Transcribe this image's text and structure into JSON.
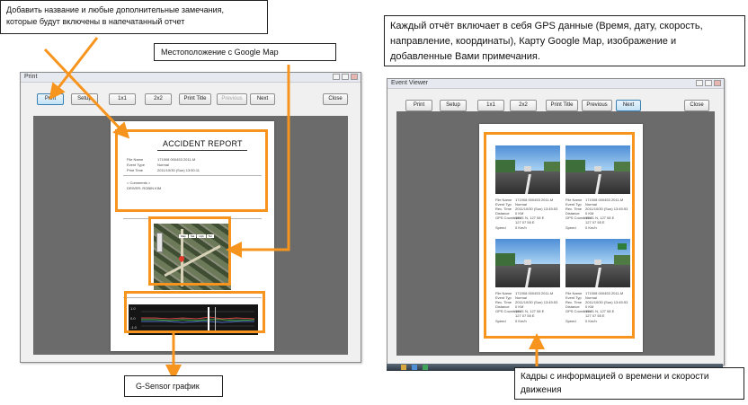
{
  "callouts": {
    "notes": [
      "Добавить название и любые дополнительные замечания,",
      "которые будут включены в напечатанный отчет"
    ],
    "google_map": "Местоположение с Google Map",
    "gps_info": [
      "Каждый отчёт включает в себя GPS данные (Время, дату, скорость,",
      "направление, координаты), Карту Google Map, изображение и",
      "добавленные Вами примечания."
    ],
    "gsensor": "G-Sensor график",
    "frames": [
      "Кадры с информацией о времени и скорости",
      "движения"
    ]
  },
  "left_window": {
    "title": "Print",
    "buttons": {
      "print": "Print",
      "setup": "Setup",
      "one_by_one": "1x1",
      "two_by_two": "2x2",
      "print_title": "Print Title",
      "previous": "Previous",
      "next": "Next",
      "close": "Close"
    },
    "report": {
      "title": "ACCIDENT REPORT",
      "fields": [
        {
          "label": "File Name",
          "value": "171908 000453 2011-M"
        },
        {
          "label": "Event Type",
          "value": "Normal"
        },
        {
          "label": "Print Time",
          "value": "2011/10/30 (Sun) 13:50:11"
        }
      ],
      "comments_label": "< Comments >",
      "comments_value": "DRIVER: ROBIN KIM"
    },
    "map_tabs": [
      "Map",
      "Sat",
      "Hyb",
      "Ter"
    ],
    "graph": {
      "y_labels": [
        "1.0",
        "0.0",
        "-1.0"
      ],
      "times": [
        "11:44:53",
        "11:44:58",
        "11:45"
      ]
    }
  },
  "right_window": {
    "title": "Event Viewer",
    "buttons": {
      "print": "Print",
      "setup": "Setup",
      "one_by_one": "1x1",
      "two_by_two": "2x2",
      "print_title": "Print Title",
      "previous": "Previous",
      "next": "Next",
      "close": "Close"
    },
    "frame_info_labels": [
      "File Name",
      "Event Typ",
      "Rec. Time",
      "Distance",
      "GPS Coordinate",
      "",
      "Speed"
    ],
    "frame_info_values": [
      "171908 000453 2011-M",
      "Normal",
      "2011/10/30 (Sun) 13:45:53",
      "0 KM",
      "37 21 N, 127 08 E",
      "127 07 55 E",
      "0 Km/h"
    ]
  },
  "colors": {
    "accent": "#f7941d",
    "pane": "#6b6b6b",
    "button_selected": "#c3e2f6"
  }
}
